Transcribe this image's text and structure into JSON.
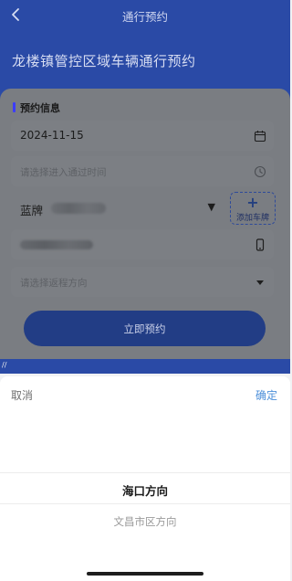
{
  "header": {
    "nav_title": "通行预约",
    "page_title": "龙楼镇管控区域车辆通行预约"
  },
  "card": {
    "section_title": "预约信息",
    "date_value": "2024-11-15",
    "time_placeholder": "请选择进入通过时间",
    "plate_type": "蓝牌",
    "plate_caret": "▼",
    "add_plate_label": "添加车牌",
    "direction_placeholder": "请选择返程方向",
    "submit_label": "立即预约"
  },
  "sheet": {
    "cancel_label": "取消",
    "confirm_label": "确定",
    "options": [
      "海口方向",
      "文昌市区方向"
    ]
  },
  "misc": {
    "mini_text": "//"
  },
  "icons": {
    "back": "chevron-left-icon",
    "calendar": "calendar-icon",
    "clock": "clock-icon",
    "phone": "phone-icon",
    "dropdown": "caret-down-icon",
    "plus": "plus-icon"
  },
  "colors": {
    "header_blue": "#2a4aa6",
    "button_blue": "#223d85",
    "confirm_blue": "#4c8fd9",
    "accent_bar": "#3c3cff"
  }
}
